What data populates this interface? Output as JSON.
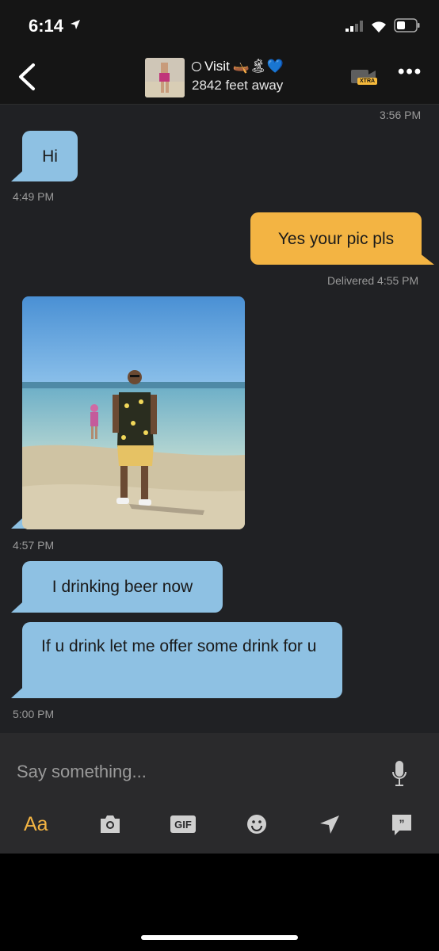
{
  "status_bar": {
    "time": "6:14"
  },
  "header": {
    "name": "Visit",
    "emojis": "🛶🏝💙",
    "distance": "2842 feet away",
    "xtra_badge": "XTRA"
  },
  "messages": [
    {
      "type": "timestamp",
      "text": "3:56 PM"
    },
    {
      "type": "incoming",
      "text": "Hi"
    },
    {
      "type": "timestamp",
      "text": "4:49 PM"
    },
    {
      "type": "outgoing",
      "text": "Yes your pic pls"
    },
    {
      "type": "timestamp",
      "text": "Delivered 4:55 PM"
    },
    {
      "type": "incoming-photo"
    },
    {
      "type": "timestamp",
      "text": "4:57 PM"
    },
    {
      "type": "incoming",
      "text": "I drinking beer now"
    },
    {
      "type": "incoming",
      "text": "If u drink let me offer some drink for u"
    },
    {
      "type": "timestamp",
      "text": "5:00 PM"
    }
  ],
  "composer": {
    "placeholder": "Say something...",
    "toolbar": {
      "text_label": "Aa",
      "gif_label": "GIF"
    }
  },
  "icons": [
    "back-icon",
    "avatar",
    "online-status-icon",
    "video-call-icon",
    "more-icon",
    "mic-icon",
    "camera-icon",
    "gif-icon",
    "emoji-icon",
    "location-icon",
    "saved-phrases-icon"
  ],
  "colors": {
    "incoming_bubble": "#8ec1e3",
    "outgoing_bubble": "#f3b443",
    "background": "#202124"
  }
}
